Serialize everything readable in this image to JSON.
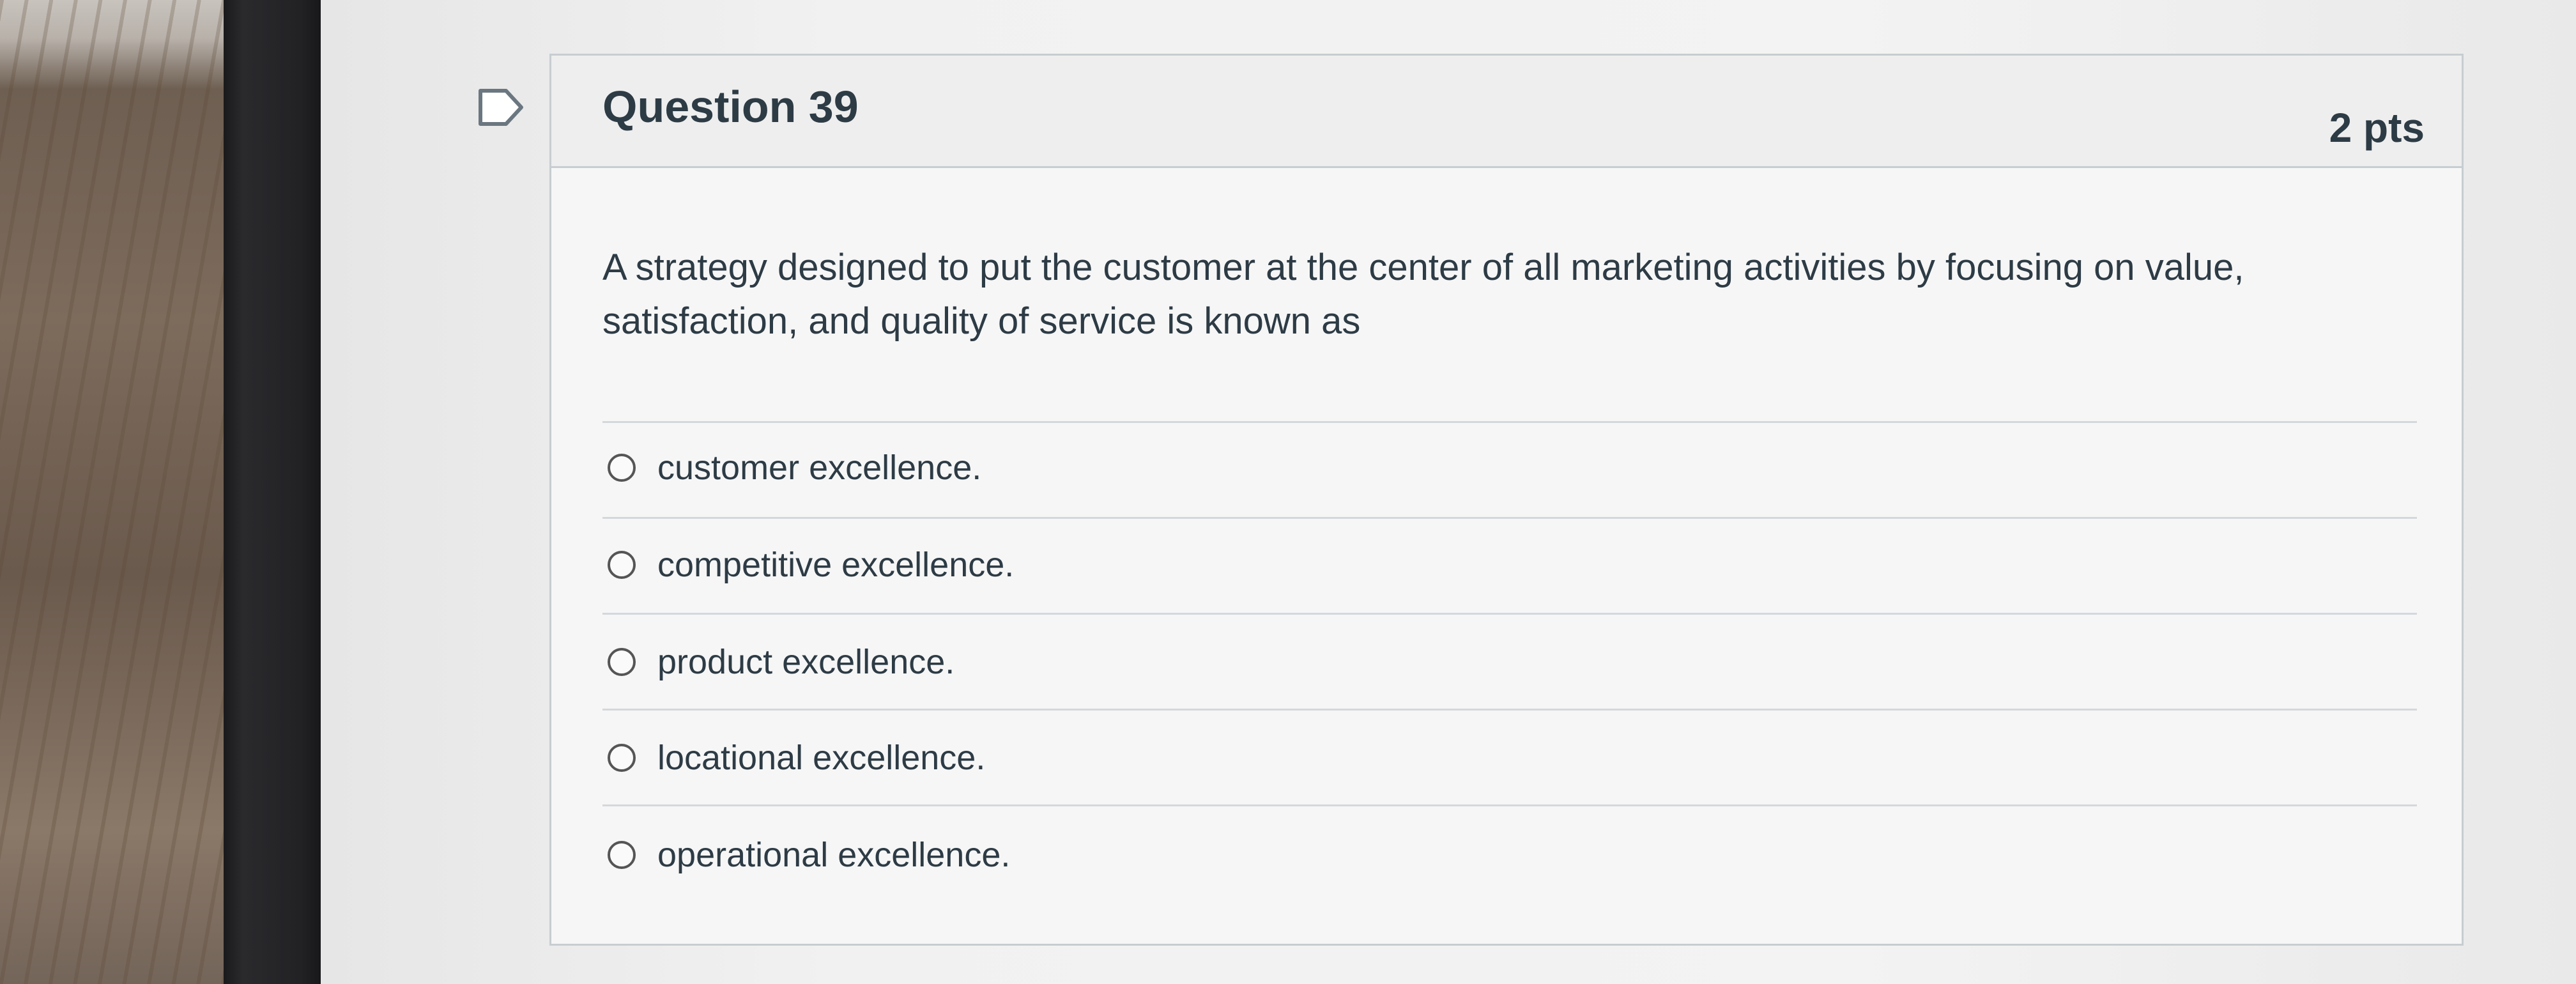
{
  "question": {
    "title": "Question 39",
    "points": "2 pts",
    "text": "A strategy designed to put the customer at the center of all marketing activities by focusing on value, satisfaction, and quality of service is known as"
  },
  "answers": [
    {
      "label": "customer excellence."
    },
    {
      "label": "competitive excellence."
    },
    {
      "label": "product excellence."
    },
    {
      "label": "locational excellence."
    },
    {
      "label": "operational excellence."
    }
  ],
  "icons": {
    "flag": "flag-question-icon",
    "radio": "radio-button-icon"
  },
  "colors": {
    "text": "#2d3b45",
    "border": "#c7cdd1",
    "header_bg": "#eeeeee"
  }
}
